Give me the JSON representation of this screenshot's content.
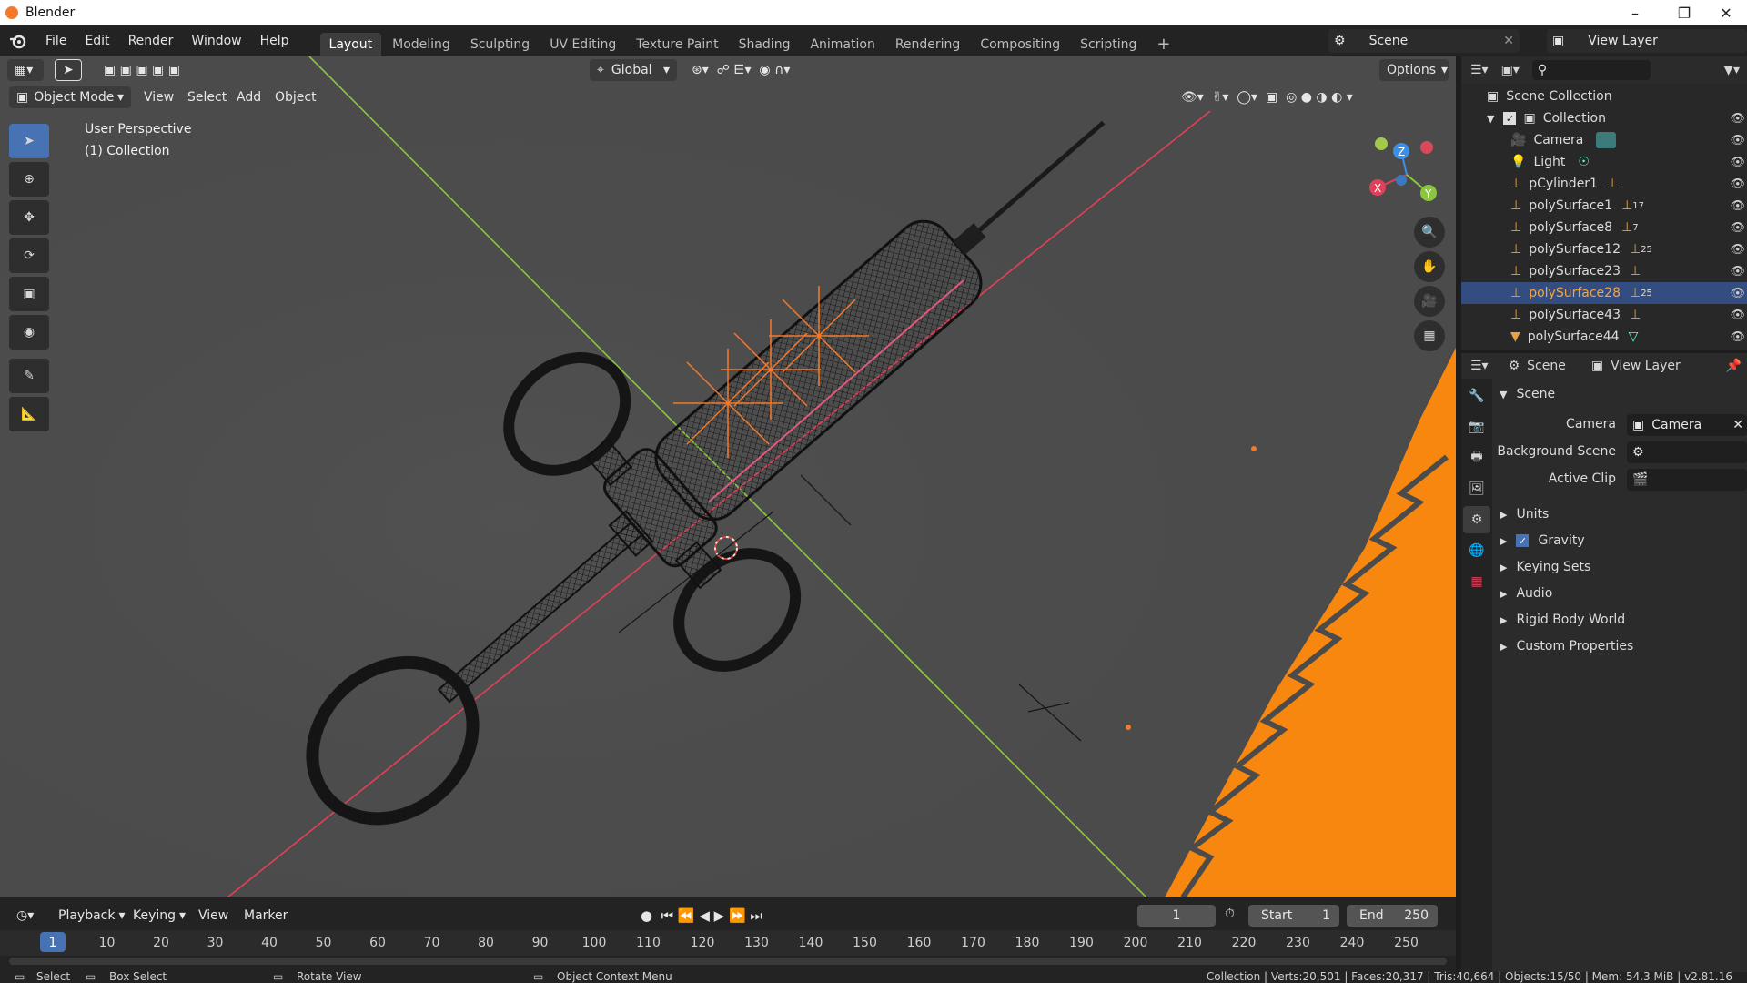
{
  "window": {
    "title": "Blender"
  },
  "menus": [
    "File",
    "Edit",
    "Render",
    "Window",
    "Help"
  ],
  "workspaces": [
    "Layout",
    "Modeling",
    "Sculpting",
    "UV Editing",
    "Texture Paint",
    "Shading",
    "Animation",
    "Rendering",
    "Compositing",
    "Scripting"
  ],
  "active_workspace": "Layout",
  "scene_selector": {
    "scene": "Scene",
    "view_layer": "View Layer"
  },
  "viewport_header": {
    "transform_orientation": "Global",
    "options": "Options",
    "mode": "Object Mode",
    "menus": [
      "View",
      "Select",
      "Add",
      "Object"
    ]
  },
  "viewport": {
    "perspective_label": "User Perspective",
    "collection_label": "(1) Collection",
    "gizmo_axes": {
      "x": "X",
      "y": "Y",
      "z": "Z"
    }
  },
  "outliner": {
    "root": "Scene Collection",
    "items": [
      {
        "label": "Collection",
        "badge": ""
      },
      {
        "label": "Camera",
        "badge": ""
      },
      {
        "label": "Light",
        "badge": ""
      },
      {
        "label": "pCylinder1",
        "badge": ""
      },
      {
        "label": "polySurface1",
        "badge": "17"
      },
      {
        "label": "polySurface8",
        "badge": "7"
      },
      {
        "label": "polySurface12",
        "badge": "25"
      },
      {
        "label": "polySurface23",
        "badge": ""
      },
      {
        "label": "polySurface28",
        "badge": "25"
      },
      {
        "label": "polySurface43",
        "badge": ""
      },
      {
        "label": "polySurface44",
        "badge": ""
      }
    ],
    "selected": "polySurface28"
  },
  "properties": {
    "breadcrumb_scene": "Scene",
    "breadcrumb_view_layer": "View Layer",
    "panel_title": "Scene",
    "fields": {
      "camera_label": "Camera",
      "camera_value": "Camera",
      "background_scene_label": "Background Scene",
      "active_clip_label": "Active Clip"
    },
    "sections": [
      "Units",
      "Gravity",
      "Keying Sets",
      "Audio",
      "Rigid Body World",
      "Custom Properties"
    ],
    "gravity_checked": true
  },
  "timeline": {
    "menus": [
      "Playback",
      "Keying",
      "View",
      "Marker"
    ],
    "current_frame": "1",
    "start_label": "Start",
    "start_value": "1",
    "end_label": "End",
    "end_value": "250",
    "ticks": [
      "1",
      "10",
      "20",
      "30",
      "40",
      "50",
      "60",
      "70",
      "80",
      "90",
      "100",
      "110",
      "120",
      "130",
      "140",
      "150",
      "160",
      "170",
      "180",
      "190",
      "200",
      "210",
      "220",
      "230",
      "240",
      "250"
    ]
  },
  "statusbar": {
    "select": "Select",
    "box_select": "Box Select",
    "rotate_view": "Rotate View",
    "context_menu": "Object Context Menu",
    "stats": "Collection | Verts:20,501 | Faces:20,317 | Tris:40,664 | Objects:15/50 | Mem: 54.3 MiB | v2.81.16"
  },
  "colors": {
    "accent": "#4772b3",
    "selection": "#f5a440",
    "x_axis": "#e0405a",
    "y_axis": "#8cc53f",
    "z_axis": "#3c8fe6"
  }
}
